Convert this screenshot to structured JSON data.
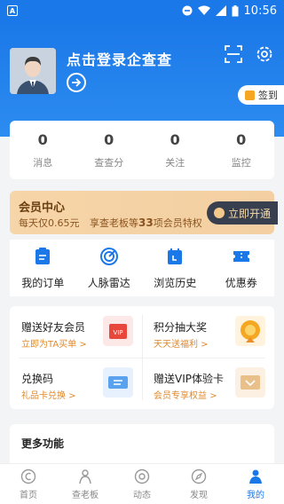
{
  "status_bar": {
    "app_badge": "A",
    "time": "10:56"
  },
  "header": {
    "login_title": "点击登录企查查",
    "sign_label": "签到"
  },
  "stats": [
    {
      "value": "0",
      "label": "消息"
    },
    {
      "value": "0",
      "label": "查查分"
    },
    {
      "value": "0",
      "label": "关注"
    },
    {
      "value": "0",
      "label": "监控"
    }
  ],
  "vip": {
    "title": "会员中心",
    "price_text": "每天仅0.65元",
    "benefit_prefix": "享查老板等",
    "benefit_count": "33",
    "benefit_suffix": "项会员特权",
    "button_label": "立即开通"
  },
  "quick": [
    {
      "label": "我的订单",
      "icon": "order-icon"
    },
    {
      "label": "人脉雷达",
      "icon": "radar-icon"
    },
    {
      "label": "浏览历史",
      "icon": "history-icon"
    },
    {
      "label": "优惠券",
      "icon": "coupon-icon"
    }
  ],
  "promo": [
    {
      "title": "赠送好友会员",
      "sub": "立即为TA买单 >",
      "icon": "vip-gift-icon"
    },
    {
      "title": "积分抽大奖",
      "sub": "天天送福利 >",
      "icon": "lottery-wheel-icon"
    },
    {
      "title": "兑换码",
      "sub": "礼品卡兑换 >",
      "icon": "ticket-icon"
    },
    {
      "title": "赠送VIP体验卡",
      "sub": "会员专享权益 >",
      "icon": "vip-card-icon"
    }
  ],
  "more": {
    "title": "更多功能"
  },
  "nav": [
    {
      "label": "首页",
      "icon": "home-icon"
    },
    {
      "label": "查老板",
      "icon": "boss-icon"
    },
    {
      "label": "动态",
      "icon": "feed-icon"
    },
    {
      "label": "发现",
      "icon": "compass-icon"
    },
    {
      "label": "我的",
      "icon": "profile-icon"
    }
  ],
  "colors": {
    "primary": "#1b78e8",
    "gold": "#f6d5a8",
    "accent_orange": "#e08a2c"
  }
}
